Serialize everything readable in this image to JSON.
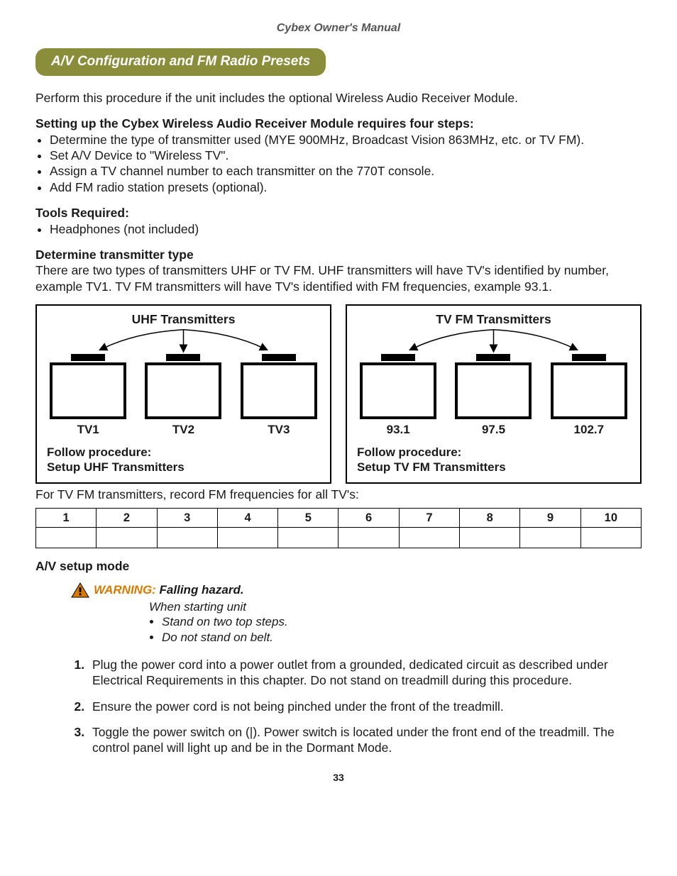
{
  "header": {
    "running": "Cybex Owner's Manual"
  },
  "section": {
    "title": "A/V Configuration and FM Radio Presets"
  },
  "intro": "Perform this procedure if the unit includes the optional Wireless Audio Receiver Module.",
  "steps_heading": "Setting up the Cybex Wireless Audio Receiver Module requires four steps:",
  "setup_steps": [
    "Determine the type of transmitter used (MYE 900MHz, Broadcast Vision 863MHz, etc. or TV FM).",
    "Set A/V Device to \"Wireless TV\".",
    "Assign a TV channel number to each transmitter on the 770T console.",
    "Add FM radio station presets (optional)."
  ],
  "tools": {
    "heading": "Tools Required:",
    "items": [
      "Headphones (not included)"
    ]
  },
  "determine": {
    "heading": "Determine transmitter type",
    "body": "There are two types of transmitters UHF or TV FM. UHF transmitters will have TV's identified by number, example TV1. TV FM transmitters will have TV's identified with FM frequencies, example 93.1."
  },
  "diagrams": {
    "uhf": {
      "title": "UHF Transmitters",
      "labels": [
        "TV1",
        "TV2",
        "TV3"
      ],
      "follow1": "Follow procedure:",
      "follow2": "Setup UHF Transmitters"
    },
    "tvfm": {
      "title": "TV FM Transmitters",
      "labels": [
        "93.1",
        "97.5",
        "102.7"
      ],
      "follow1": "Follow procedure:",
      "follow2": "Setup TV FM Transmitters"
    }
  },
  "freq_note": "For TV FM transmitters, record FM frequencies for all TV's:",
  "freq_headers": [
    "1",
    "2",
    "3",
    "4",
    "5",
    "6",
    "7",
    "8",
    "9",
    "10"
  ],
  "av_mode": {
    "heading": "A/V setup mode"
  },
  "warning": {
    "label": "WARNING:",
    "title": " Falling hazard.",
    "line": "When starting unit",
    "items": [
      "Stand on two top steps.",
      "Do not stand on belt."
    ]
  },
  "numbered": [
    "Plug the power cord into a power outlet from a grounded, dedicated circuit as described under Electrical Requirements in this chapter. Do not stand on treadmill during this procedure.",
    "Ensure the power cord is not being pinched under the front of the treadmill.",
    "Toggle the power switch on (|). Power switch is located under the front end of the treadmill. The control panel will light up and be in the Dormant Mode."
  ],
  "page": "33"
}
